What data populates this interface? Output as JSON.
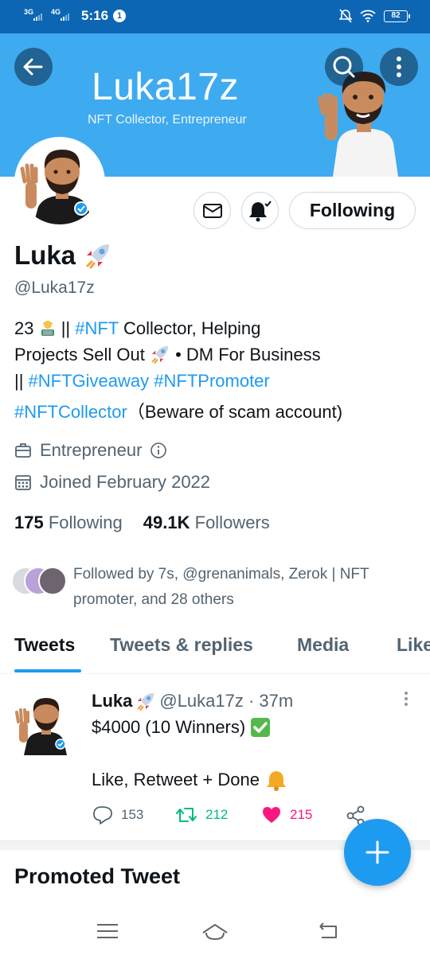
{
  "status_bar": {
    "net1": "3G",
    "net2": "4G",
    "time": "5:16",
    "info_badge": "1",
    "battery": "82"
  },
  "banner": {
    "title": "Luka17z",
    "subtitle": "NFT Collector, Entrepreneur"
  },
  "profile": {
    "name": "Luka",
    "name_emoji": "rocket",
    "handle": "@Luka17z",
    "following_button": "Following",
    "bio": {
      "line1_a": "23 ",
      "line1_b": " || ",
      "line1_tag": "#NFT",
      "line1_c": " Collector, Helping",
      "line2_a": "Projects Sell Out ",
      "line2_b": " • DM For Business",
      "line3_a": "|| ",
      "line3_tag1": "#NFTGiveaway",
      "line3_sp": " ",
      "line3_tag2": "#NFTPromoter",
      "line4_tag": "#NFTCollector",
      "line4_b": "（Beware of scam account)"
    },
    "category": "Entrepreneur",
    "joined": "Joined February 2022",
    "following_count": "175",
    "following_label": "Following",
    "followers_count": "49.1K",
    "followers_label": "Followers",
    "followed_by": "Followed by 7s, @grenanimals, Zerok | NFT promoter, and 28 others"
  },
  "tabs": [
    {
      "label": "Tweets",
      "active": true
    },
    {
      "label": "Tweets & replies",
      "active": false
    },
    {
      "label": "Media",
      "active": false
    },
    {
      "label": "Likes",
      "active": false
    }
  ],
  "tweet": {
    "name": "Luka",
    "handle_time": "@Luka17z · 37m",
    "text_line1": "$4000 (10 Winners)",
    "text_line2": "Like, Retweet + Done",
    "replies": "153",
    "retweets": "212",
    "likes": "215"
  },
  "promoted_heading": "Promoted Tweet",
  "colors": {
    "banner": "#3eaaf0",
    "status_bar": "#0c66b4",
    "accent": "#1d9bf0",
    "retweet": "#00ba7c",
    "like": "#f91880"
  }
}
